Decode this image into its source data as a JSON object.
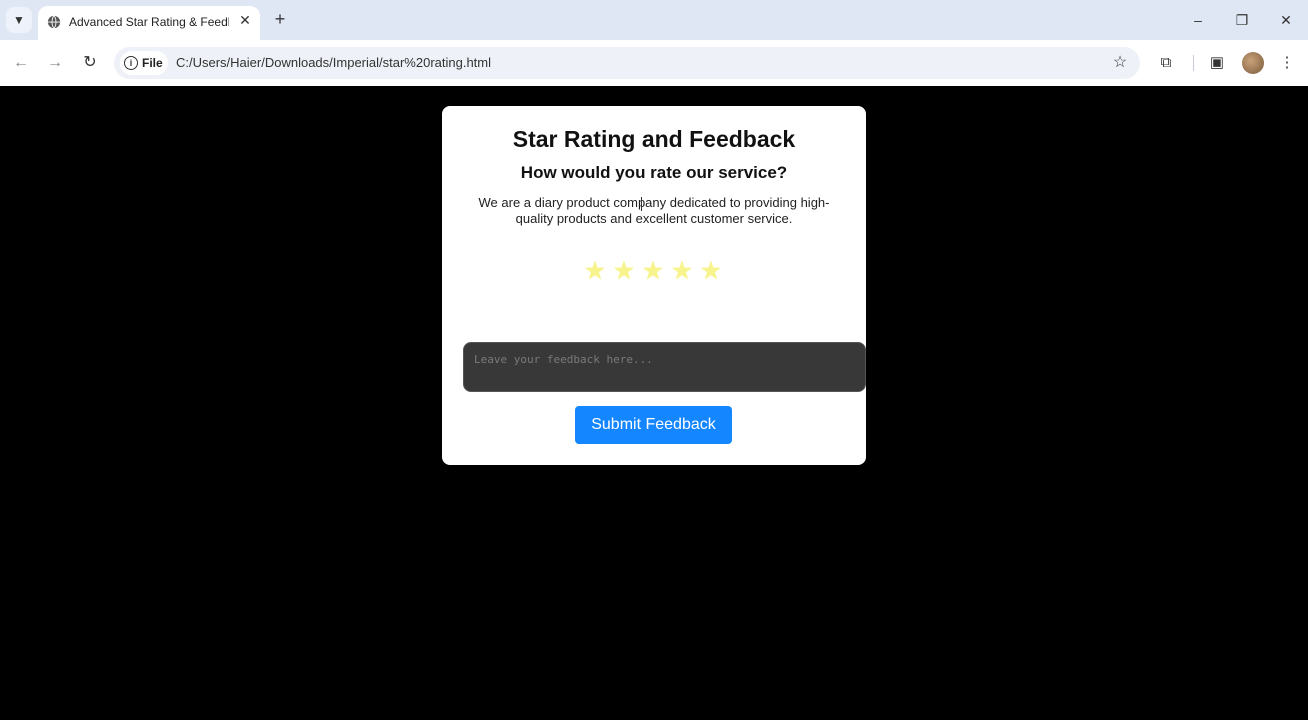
{
  "browser": {
    "tab_list_icon": "chevron-down-icon",
    "tab": {
      "title": "Advanced Star Rating & Feedba",
      "favicon": "globe-icon",
      "close_glyph": "✕"
    },
    "new_tab_glyph": "+",
    "window_controls": {
      "minimize": "–",
      "restore": "❐",
      "close": "✕"
    },
    "nav": {
      "back": "←",
      "forward": "→",
      "reload": "↻"
    },
    "site_chip_label": "File",
    "url": "C:/Users/Haier/Downloads/Imperial/star%20rating.html",
    "bookmark_glyph": "☆",
    "extensions_glyph": "⧉",
    "sidepanel_glyph": "▣",
    "menu_glyph": "⋮"
  },
  "page": {
    "background": "#000000",
    "card": {
      "title": "Star Rating and Feedback",
      "subtitle": "How would you rate our service?",
      "description": "We are a diary product company dedicated to providing high-quality products and excellent customer service.",
      "stars": [
        "★",
        "★",
        "★",
        "★",
        "★"
      ],
      "star_color": "#f7f48e",
      "rating_selected": 0,
      "feedback_placeholder": "Leave your feedback here...",
      "submit_label": "Submit Feedback",
      "submit_color": "#1486ff"
    }
  }
}
